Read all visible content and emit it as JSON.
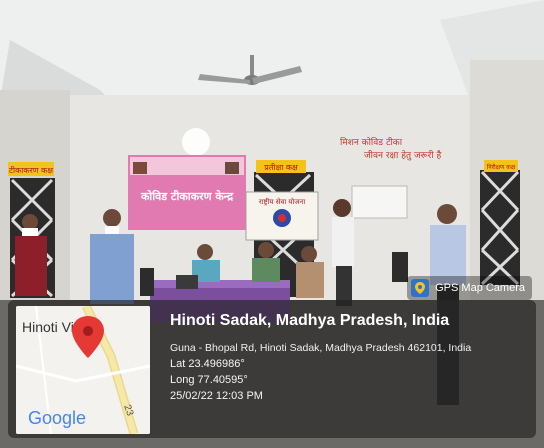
{
  "watermark": {
    "app_name": "GPS Map Camera",
    "app_icon": "gps-pin-icon"
  },
  "map": {
    "place_label": "Hinoti Village",
    "road_label": "23",
    "brand": "Google",
    "pin_color": "#e53935"
  },
  "location": {
    "title": "Hinoti Sadak, Madhya Pradesh, India",
    "address": "Guna - Bhopal Rd, Hinoti Sadak, Madhya Pradesh 462101, India",
    "lat": "Lat 23.496986°",
    "long": "Long 77.40595°",
    "datetime": "25/02/22 12:03 PM"
  },
  "scene": {
    "banner_left": "कोविड टीकाकरण केन्द्र",
    "banner_right": "राष्ट्रीय सेवा योजना",
    "wall_sign_left": "टीकाकरण कक्ष",
    "wall_sign_center": "प्रतीक्षा कक्ष",
    "wall_sign_right": "निरीक्षण कक्ष",
    "wall_text_1": "मिशन कोविड टीका",
    "wall_text_2": "जीवन रक्षा हेतु जरूरी है"
  }
}
